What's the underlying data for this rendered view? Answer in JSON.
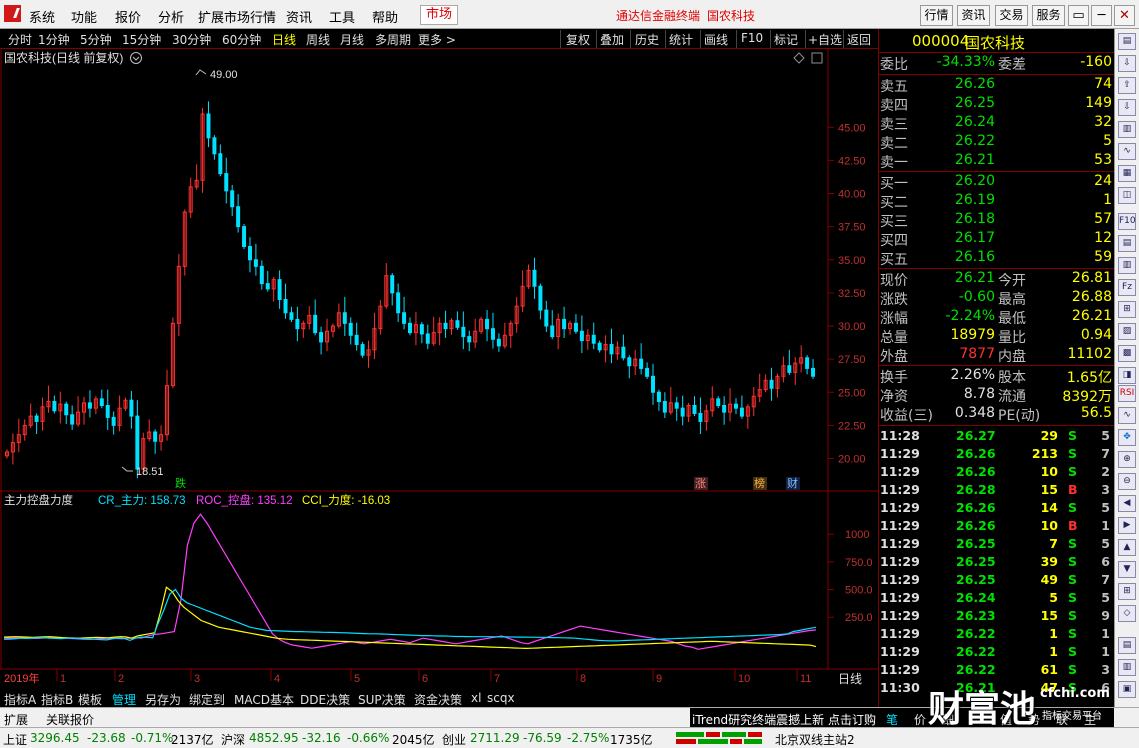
{
  "menu": {
    "items": [
      "系统",
      "功能",
      "报价",
      "分析",
      "扩展市场行情",
      "资讯",
      "工具",
      "帮助"
    ],
    "market_tab": "市场",
    "app_title": "通达信金融终端",
    "stock_title": "国农科技",
    "right_buttons": [
      "行情",
      "资讯",
      "交易",
      "服务"
    ],
    "window_buttons": [
      "▭",
      "─",
      "□",
      "✕"
    ]
  },
  "periods": {
    "items": [
      "分时",
      "1分钟",
      "5分钟",
      "15分钟",
      "30分钟",
      "60分钟",
      "日线",
      "周线",
      "月线",
      "多周期",
      "更多 >"
    ],
    "active": "日线",
    "tools": [
      "复权",
      "叠加",
      "历史",
      "统计",
      "画线",
      "F10",
      "+自选",
      "返回"
    ],
    "mark_label": "标记"
  },
  "chart": {
    "stock_label": "国农科技(日线 前复权)",
    "indicator_label": "主力控盘力度",
    "ind_cr": "CR_主力: 158.73",
    "ind_roc": "ROC_控盘: 135.12",
    "ind_cci": "CCI_力度: -16.03",
    "high_label": "49.00",
    "low_label": "18.51",
    "event_labels": [
      "跌",
      "涨",
      "榜",
      "财"
    ],
    "period_label": "日线",
    "year_label": "2019年"
  },
  "chart_data": {
    "type": "candlestick",
    "price_axis": [
      20.0,
      22.5,
      25.0,
      27.5,
      30.0,
      32.5,
      35.0,
      37.5,
      40.0,
      42.5,
      45.0
    ],
    "price_ylim": [
      18.0,
      50.0
    ],
    "indicator_axis": [
      250.0,
      500.0,
      750.0,
      1000
    ],
    "indicator_ylim": [
      -200,
      1300
    ],
    "months": [
      "1",
      "2",
      "3",
      "4",
      "5",
      "6",
      "7",
      "8",
      "9",
      "10",
      "11"
    ],
    "max_price": 49.0,
    "min_price": 18.51,
    "close_trend": [
      20.5,
      21.2,
      21.8,
      22.5,
      23.2,
      22.8,
      23.9,
      24.3,
      23.6,
      24.1,
      23.3,
      22.6,
      23.5,
      24.2,
      23.8,
      24.5,
      24.0,
      23.1,
      22.5,
      23.8,
      24.4,
      23.2,
      19.2,
      21.5,
      22.0,
      21.3,
      21.8,
      25.5,
      30.2,
      34.5,
      38.6,
      40.5,
      41.0,
      46.0,
      44.2,
      43.0,
      41.5,
      40.2,
      39.0,
      37.5,
      36.0,
      35.0,
      34.5,
      33.2,
      32.8,
      33.5,
      32.0,
      31.0,
      30.5,
      29.8,
      30.2,
      30.8,
      29.5,
      28.8,
      29.6,
      30.0,
      31.0,
      30.2,
      29.3,
      28.6,
      27.8,
      28.2,
      29.8,
      31.5,
      33.8,
      32.5,
      31.0,
      30.2,
      29.5,
      30.1,
      29.4,
      28.7,
      29.5,
      30.2,
      29.8,
      30.4,
      29.9,
      29.2,
      28.8,
      29.6,
      30.5,
      29.8,
      29.0,
      28.5,
      29.3,
      30.2,
      31.5,
      33.0,
      34.2,
      33.0,
      31.2,
      30.0,
      29.2,
      30.5,
      29.8,
      30.2,
      29.6,
      28.9,
      29.3,
      28.7,
      28.2,
      28.6,
      27.9,
      28.4,
      27.6,
      27.0,
      27.5,
      26.8,
      26.2,
      25.0,
      24.3,
      23.5,
      24.2,
      23.8,
      23.2,
      24.0,
      23.4,
      22.8,
      23.6,
      24.5,
      24.0,
      23.5,
      24.1,
      23.8,
      23.2,
      23.9,
      24.7,
      25.2,
      25.9,
      25.3,
      26.2,
      27.0,
      26.5,
      27.2,
      27.6,
      26.8,
      26.21
    ],
    "cr_trend": [
      50,
      52,
      55,
      60,
      58,
      62,
      64,
      66,
      60,
      58,
      56,
      60,
      62,
      58,
      55,
      52,
      50,
      48,
      45,
      55,
      62,
      58,
      40,
      60,
      70,
      68,
      65,
      200,
      320,
      460,
      500,
      420,
      380,
      360,
      340,
      320,
      300,
      280,
      260,
      240,
      220,
      200,
      180,
      160,
      150,
      140,
      130,
      128,
      126,
      124,
      122,
      120,
      120,
      118,
      116,
      115,
      114,
      113,
      112,
      110,
      108,
      106,
      104,
      102,
      100,
      100,
      98,
      96,
      94,
      92,
      90,
      88,
      86,
      84,
      84,
      82,
      80,
      80,
      78,
      76,
      76,
      75,
      74,
      74,
      74,
      74,
      73,
      72,
      72,
      71,
      70,
      70,
      69,
      68,
      68,
      67,
      66,
      65,
      64,
      62,
      60,
      55,
      50,
      45,
      40,
      38,
      36,
      36,
      38,
      40,
      42,
      44,
      46,
      48,
      50,
      52,
      54,
      56,
      58,
      60,
      62,
      64,
      66,
      68,
      70,
      72,
      74,
      76,
      78,
      80,
      82,
      84,
      86,
      88,
      90,
      92,
      95,
      100,
      120,
      130,
      140,
      150,
      158.73
    ],
    "roc_trend": [
      60,
      62,
      64,
      62,
      60,
      58,
      62,
      66,
      64,
      62,
      58,
      55,
      52,
      50,
      55,
      58,
      60,
      58,
      55,
      60,
      64,
      62,
      80,
      95,
      100,
      110,
      120,
      400,
      900,
      1100,
      1180,
      1100,
      1000,
      900,
      800,
      700,
      600,
      500,
      400,
      300,
      200,
      100,
      50,
      20,
      0,
      -10,
      -20,
      -30,
      -20,
      -10,
      0,
      10,
      20,
      30,
      20,
      10,
      20,
      30,
      40,
      50,
      40,
      30,
      20,
      40,
      60,
      50,
      40,
      30,
      20,
      10,
      20,
      30,
      40,
      50,
      60,
      70,
      80,
      60,
      40,
      20,
      10,
      30,
      50,
      70,
      90,
      110,
      130,
      150,
      170,
      160,
      150,
      140,
      130,
      120,
      110,
      100,
      90,
      80,
      70,
      60,
      50,
      40,
      30,
      10,
      -10,
      -20,
      -40,
      -30,
      -20,
      -10,
      0,
      10,
      20,
      30,
      40,
      50,
      60,
      70,
      80,
      90,
      100,
      110,
      120,
      130,
      135.12
    ],
    "cci_trend": [
      70,
      72,
      74,
      72,
      70,
      68,
      70,
      72,
      74,
      70,
      66,
      64,
      62,
      60,
      64,
      66,
      68,
      66,
      64,
      70,
      74,
      72,
      60,
      80,
      90,
      100,
      110,
      300,
      520,
      480,
      400,
      340,
      300,
      260,
      220,
      200,
      180,
      160,
      150,
      140,
      130,
      120,
      110,
      100,
      90,
      80,
      70,
      60,
      55,
      50,
      48,
      46,
      44,
      42,
      40,
      38,
      36,
      34,
      32,
      30,
      28,
      26,
      24,
      22,
      20,
      18,
      16,
      14,
      12,
      10,
      8,
      6,
      4,
      2,
      0,
      -2,
      -4,
      -6,
      -8,
      -10,
      -12,
      -14,
      -16,
      -18,
      -20,
      -22,
      -24,
      -26,
      -28,
      -30,
      -32,
      -30,
      -28,
      -26,
      -24,
      -22,
      -20,
      -18,
      -16,
      -14,
      -12,
      -10,
      -8,
      -6,
      -4,
      -2,
      0,
      2,
      4,
      6,
      8,
      10,
      12,
      14,
      16,
      18,
      20,
      22,
      24,
      26,
      28,
      30,
      32,
      30,
      28,
      26,
      24,
      22,
      20,
      18,
      16,
      14,
      12,
      10,
      8,
      6,
      4,
      2,
      0,
      -2,
      -16.03
    ]
  },
  "quote": {
    "code": "000004",
    "name": "国农科技",
    "weibi_label": "委比",
    "weibi": "-34.33%",
    "weicha_label": "委差",
    "weicha": "-160",
    "asks": [
      {
        "label": "卖五",
        "price": "26.26",
        "vol": "74"
      },
      {
        "label": "卖四",
        "price": "26.25",
        "vol": "149"
      },
      {
        "label": "卖三",
        "price": "26.24",
        "vol": "32"
      },
      {
        "label": "卖二",
        "price": "26.22",
        "vol": "5"
      },
      {
        "label": "卖一",
        "price": "26.21",
        "vol": "53"
      }
    ],
    "bids": [
      {
        "label": "买一",
        "price": "26.20",
        "vol": "24"
      },
      {
        "label": "买二",
        "price": "26.19",
        "vol": "1"
      },
      {
        "label": "买三",
        "price": "26.18",
        "vol": "57"
      },
      {
        "label": "买四",
        "price": "26.17",
        "vol": "12"
      },
      {
        "label": "买五",
        "price": "26.16",
        "vol": "59"
      }
    ],
    "stats": [
      {
        "l1": "现价",
        "v1": "26.21",
        "c1": "green",
        "l2": "今开",
        "v2": "26.81",
        "c2": "white"
      },
      {
        "l1": "涨跌",
        "v1": "-0.60",
        "c1": "green",
        "l2": "最高",
        "v2": "26.88",
        "c2": "red"
      },
      {
        "l1": "涨幅",
        "v1": "-2.24%",
        "c1": "green",
        "l2": "最低",
        "v2": "26.21",
        "c2": "green"
      },
      {
        "l1": "总量",
        "v1": "18979",
        "c1": "yellow",
        "l2": "量比",
        "v2": "0.94",
        "c2": "yellow"
      },
      {
        "l1": "外盘",
        "v1": "7877",
        "c1": "red",
        "l2": "内盘",
        "v2": "11102",
        "c2": "green"
      }
    ],
    "stats2": [
      {
        "l1": "换手",
        "v1": "2.26%",
        "l2": "股本",
        "v2": "1.65亿"
      },
      {
        "l1": "净资",
        "v1": "8.78",
        "l2": "流通",
        "v2": "8392万"
      },
      {
        "l1": "收益(三)",
        "v1": "0.348",
        "l2": "PE(动)",
        "v2": "56.5"
      }
    ],
    "ticks": [
      {
        "t": "11:28",
        "p": "26.27",
        "v": "29",
        "s": "S",
        "n": "5"
      },
      {
        "t": "11:29",
        "p": "26.26",
        "v": "213",
        "s": "S",
        "n": "7"
      },
      {
        "t": "11:29",
        "p": "26.26",
        "v": "10",
        "s": "S",
        "n": "2"
      },
      {
        "t": "11:29",
        "p": "26.28",
        "v": "15",
        "s": "B",
        "n": "3"
      },
      {
        "t": "11:29",
        "p": "26.26",
        "v": "14",
        "s": "S",
        "n": "5"
      },
      {
        "t": "11:29",
        "p": "26.26",
        "v": "10",
        "s": "B",
        "n": "1"
      },
      {
        "t": "11:29",
        "p": "26.25",
        "v": "7",
        "s": "S",
        "n": "5"
      },
      {
        "t": "11:29",
        "p": "26.25",
        "v": "39",
        "s": "S",
        "n": "6"
      },
      {
        "t": "11:29",
        "p": "26.25",
        "v": "49",
        "s": "S",
        "n": "7"
      },
      {
        "t": "11:29",
        "p": "26.24",
        "v": "5",
        "s": "S",
        "n": "5"
      },
      {
        "t": "11:29",
        "p": "26.23",
        "v": "15",
        "s": "S",
        "n": "9"
      },
      {
        "t": "11:29",
        "p": "26.22",
        "v": "1",
        "s": "S",
        "n": "1"
      },
      {
        "t": "11:29",
        "p": "26.22",
        "v": "1",
        "s": "S",
        "n": "1"
      },
      {
        "t": "11:29",
        "p": "26.22",
        "v": "61",
        "s": "S",
        "n": "3"
      },
      {
        "t": "11:30",
        "p": "26.21",
        "v": "47",
        "s": "S",
        "n": "6"
      }
    ]
  },
  "bottom_tabs": [
    "指标A",
    "指标B",
    "模板",
    "管理",
    "另存为",
    "绑定到",
    "MACD基本",
    "DDE决策",
    "SUP决策",
    "资金决策",
    "xl",
    "scqx"
  ],
  "bottom_tab_active": "管理",
  "status1": {
    "left_tabs": [
      "扩展",
      "关联报价"
    ],
    "news_ticker": "iTrend研究终端震撼上新 点击订购",
    "right_tabs": [
      "笔",
      "价",
      "细",
      "值",
      "势",
      "联",
      "主"
    ]
  },
  "status2": {
    "indices": [
      {
        "name": "上证",
        "val": "3296.45",
        "chg": "-23.68",
        "pct": "-0.71%",
        "amt": "2137亿"
      },
      {
        "name": "沪深",
        "val": "4852.95",
        "chg": "-32.16",
        "pct": "-0.66%",
        "amt": "2045亿"
      },
      {
        "name": "创业",
        "val": "2711.29",
        "chg": "-76.59",
        "pct": "-2.75%",
        "amt": "1735亿"
      }
    ],
    "server": "北京双线主站2"
  },
  "watermark": {
    "brand": "财富池",
    "url": "cfchi.com",
    "sub": "指标交易平台"
  },
  "colors": {
    "up": "#ff3030",
    "down": "#00e0ff",
    "ma_white": "#ffffff",
    "cr": "#00e0ff",
    "roc": "#ff40ff",
    "cci": "#ffff00"
  }
}
